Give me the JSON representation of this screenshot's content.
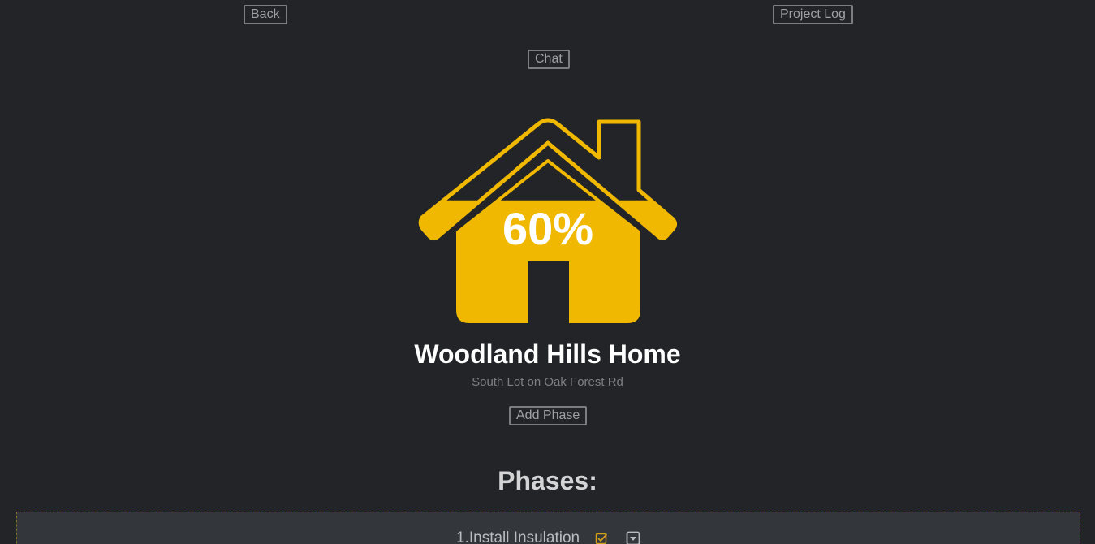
{
  "nav": {
    "back_label": "Back",
    "project_log_label": "Project Log",
    "chat_label": "Chat"
  },
  "project": {
    "progress_percent": 60,
    "progress_text": "60%",
    "title": "Woodland Hills Home",
    "subtitle": "South Lot on Oak Forest Rd",
    "add_phase_label": "Add Phase"
  },
  "phases": {
    "heading": "Phases:",
    "items": [
      {
        "label": "1.Install Insulation",
        "checkbox_icon": "check-square-icon",
        "toggle_icon": "caret-down-square-icon"
      }
    ]
  },
  "colors": {
    "background": "#222428",
    "accent": "#f0b800",
    "phase_panel": "#33363b"
  }
}
